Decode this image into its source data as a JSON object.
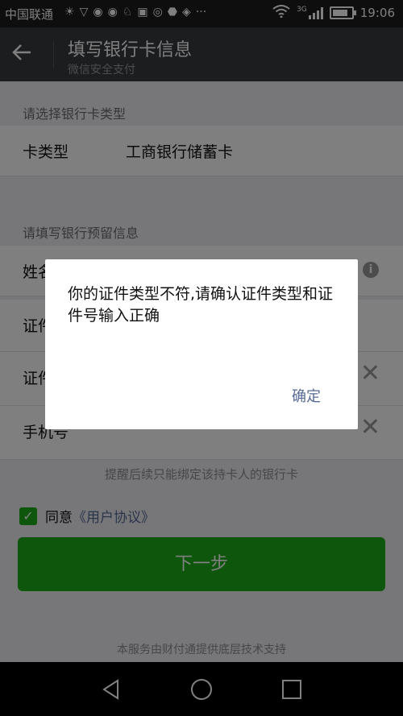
{
  "status_bar": {
    "carrier": "中国联通",
    "network_tag": "3G",
    "time": "19:06"
  },
  "header": {
    "title": "填写银行卡信息",
    "subtitle": "微信安全支付"
  },
  "card_type_section": {
    "label": "请选择银行卡类型",
    "row_label": "卡类型",
    "row_value": "工商银行储蓄卡"
  },
  "info_section": {
    "label": "请填写银行预留信息",
    "name_label": "姓名",
    "id_type_label": "证件类型",
    "id_number_label": "证件号",
    "phone_label": "手机号"
  },
  "hint": "提醒后续只能绑定该持卡人的银行卡",
  "agreement": {
    "prefix": "同意",
    "link": "《用户协议》"
  },
  "next_button": "下一步",
  "footer": "本服务由财付通提供底层技术支持",
  "dialog": {
    "message": "你的证件类型不符,请确认证件类型和证件号输入正确",
    "ok_label": "确定"
  },
  "colors": {
    "accent_green": "#1aad19",
    "link_blue": "#576b95",
    "header_bg": "#393a3f"
  }
}
